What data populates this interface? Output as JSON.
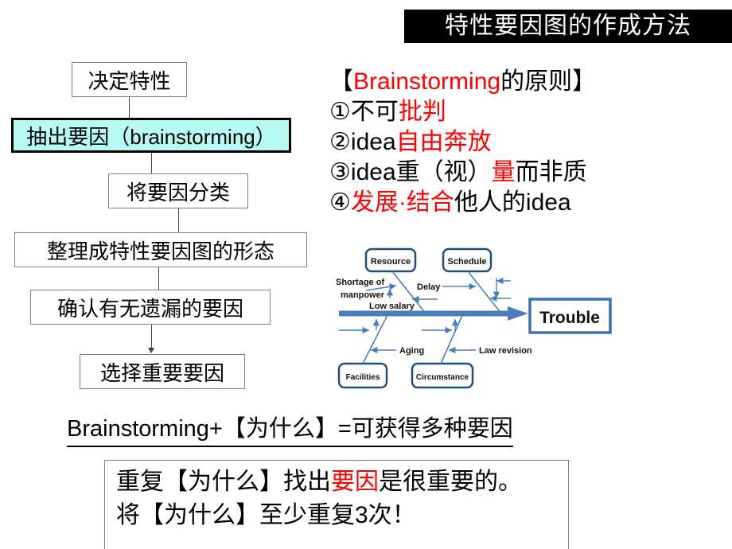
{
  "title": "特性要因图的作成方法",
  "flowchart": {
    "steps": [
      {
        "label": "决定特性",
        "highlight": false
      },
      {
        "label": "抽出要因（brainstorming）",
        "highlight": true
      },
      {
        "label": "将要因分类",
        "highlight": false
      },
      {
        "label": "整理成特性要因图的形态",
        "highlight": false
      },
      {
        "label": "确认有无遗漏的要因",
        "highlight": false
      },
      {
        "label": "选择重要要因",
        "highlight": false
      }
    ],
    "highlight_color": "#b7fbf5"
  },
  "principles": {
    "heading": {
      "bracket_open": "【",
      "term": "Brainstorming",
      "rest": "的原则",
      "bracket_close": "】"
    },
    "items": [
      {
        "marker": "①",
        "parts": [
          {
            "text": "不可",
            "color": "black"
          },
          {
            "text": "批判",
            "color": "red"
          }
        ]
      },
      {
        "marker": "②",
        "parts": [
          {
            "text": "idea",
            "color": "black"
          },
          {
            "text": "自由奔放",
            "color": "red"
          }
        ]
      },
      {
        "marker": "③",
        "parts": [
          {
            "text": "idea重（视）",
            "color": "black"
          },
          {
            "text": "量",
            "color": "red"
          },
          {
            "text": "而非质",
            "color": "black"
          }
        ]
      },
      {
        "marker": "④",
        "parts": [
          {
            "text": "发展·结合",
            "color": "red"
          },
          {
            "text": "他人的idea",
            "color": "black"
          }
        ]
      }
    ],
    "accent_color": "#ff0000"
  },
  "fishbone": {
    "effect": "Trouble",
    "categories": [
      {
        "name": "Resource",
        "position": "top-left"
      },
      {
        "name": "Schedule",
        "position": "top-right"
      },
      {
        "name": "Facilities",
        "position": "bottom-left"
      },
      {
        "name": "Circumstance",
        "position": "bottom-right"
      }
    ],
    "causes": [
      {
        "line1": "Shortage of",
        "line2": "manpower"
      },
      {
        "line1": "Low salary",
        "line2": ""
      },
      {
        "line1": "Delay",
        "line2": ""
      },
      {
        "line1": "Aging",
        "line2": ""
      },
      {
        "line1": "Law revision",
        "line2": ""
      }
    ],
    "spine_color": "#4a7ebb",
    "box_border_color": "#1f4e79"
  },
  "statement": "Brainstorming+【为什么】=可获得多种要因",
  "bottom_box": {
    "line1": {
      "prefix": "重复【为什么】找出",
      "emphasis": "要因",
      "suffix": "是很重要的。"
    },
    "line2": "将【为什么】至少重复3次！"
  }
}
